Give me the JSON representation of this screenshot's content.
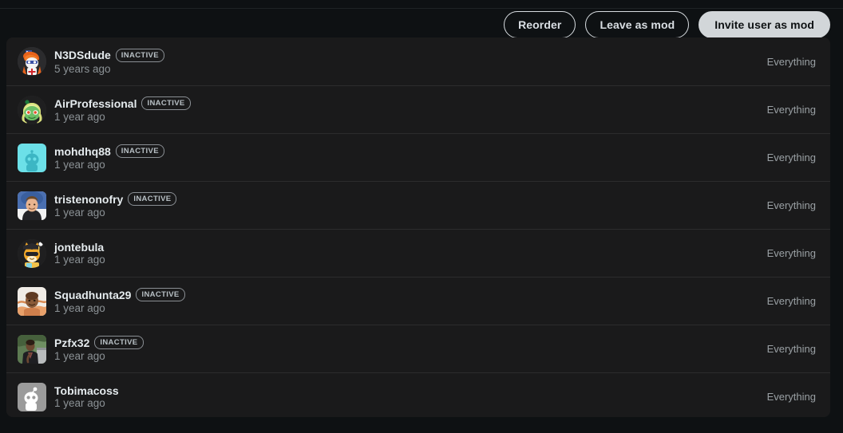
{
  "toolbar": {
    "buttons": [
      {
        "label": "Reorder",
        "style": "outline",
        "name": "reorder-button"
      },
      {
        "label": "Leave as mod",
        "style": "outline",
        "name": "leave-as-mod-button"
      },
      {
        "label": "Invite user as mod",
        "style": "filled",
        "name": "invite-user-as-mod-button"
      }
    ]
  },
  "colors": {
    "page_background": "#0e1113",
    "card_background": "#1a1a1b",
    "row_divider": "#2c2c2d",
    "primary_text": "#e5ebee",
    "secondary_text": "#8c9296",
    "accent_button_fill": "#d2d6d9",
    "badge_border": "#8a8f94"
  },
  "moderator_list": {
    "permission_label": "Everything",
    "badge_label": "INACTIVE",
    "rows": [
      {
        "username": "N3DSdude",
        "inactive": true,
        "badge": "INACTIVE",
        "timeago": "5 years ago",
        "permissions": "Everything",
        "avatar": "avatar-n3dsdude",
        "avatar_shape": "circle"
      },
      {
        "username": "AirProfessional",
        "inactive": true,
        "badge": "INACTIVE",
        "timeago": "1 year ago",
        "permissions": "Everything",
        "avatar": "avatar-airprofessional",
        "avatar_shape": "circle"
      },
      {
        "username": "mohdhq88",
        "inactive": true,
        "badge": "INACTIVE",
        "timeago": "1 year ago",
        "permissions": "Everything",
        "avatar": "avatar-mohdhq88",
        "avatar_shape": "squared"
      },
      {
        "username": "tristenonofry",
        "inactive": true,
        "badge": "INACTIVE",
        "timeago": "1 year ago",
        "permissions": "Everything",
        "avatar": "avatar-tristenonofry",
        "avatar_shape": "squared"
      },
      {
        "username": "jontebula",
        "inactive": false,
        "badge": "",
        "timeago": "1 year ago",
        "permissions": "Everything",
        "avatar": "avatar-jontebula",
        "avatar_shape": "circle"
      },
      {
        "username": "Squadhunta29",
        "inactive": true,
        "badge": "INACTIVE",
        "timeago": "1 year ago",
        "permissions": "Everything",
        "avatar": "avatar-squadhunta29",
        "avatar_shape": "squared"
      },
      {
        "username": "Pzfx32",
        "inactive": true,
        "badge": "INACTIVE",
        "timeago": "1 year ago",
        "permissions": "Everything",
        "avatar": "avatar-pzfx32",
        "avatar_shape": "squared"
      },
      {
        "username": "Tobimacoss",
        "inactive": false,
        "badge": "",
        "timeago": "1 year ago",
        "permissions": "Everything",
        "avatar": "avatar-tobimacoss",
        "avatar_shape": "squared"
      }
    ]
  }
}
